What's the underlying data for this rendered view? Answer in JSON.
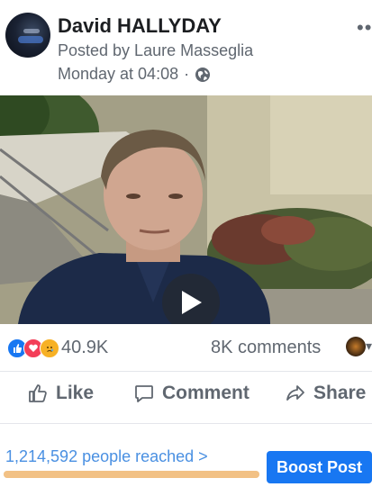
{
  "post": {
    "page_name": "David HALLYDAY",
    "posted_by": "Posted by Laure Masseglia",
    "time": "Monday at 04:08",
    "dot": "·"
  },
  "video": {
    "play_icon": "play-icon"
  },
  "reactions": {
    "icons": [
      "like-reaction-icon",
      "love-reaction-icon",
      "sad-reaction-icon"
    ],
    "count": "40.9K",
    "comments": "8K comments"
  },
  "actions": {
    "like_label": "Like",
    "comment_label": "Comment",
    "share_label": "Share"
  },
  "footer": {
    "reached_text": "1,214,592 people reached >",
    "boost_label": "Boost Post",
    "reach_progress": 1.0
  },
  "colors": {
    "accent": "#1877f2",
    "reach_link": "#4a90e2",
    "reach_bar": "#f2c185",
    "love": "#f33e58",
    "sad": "#f7b125"
  }
}
